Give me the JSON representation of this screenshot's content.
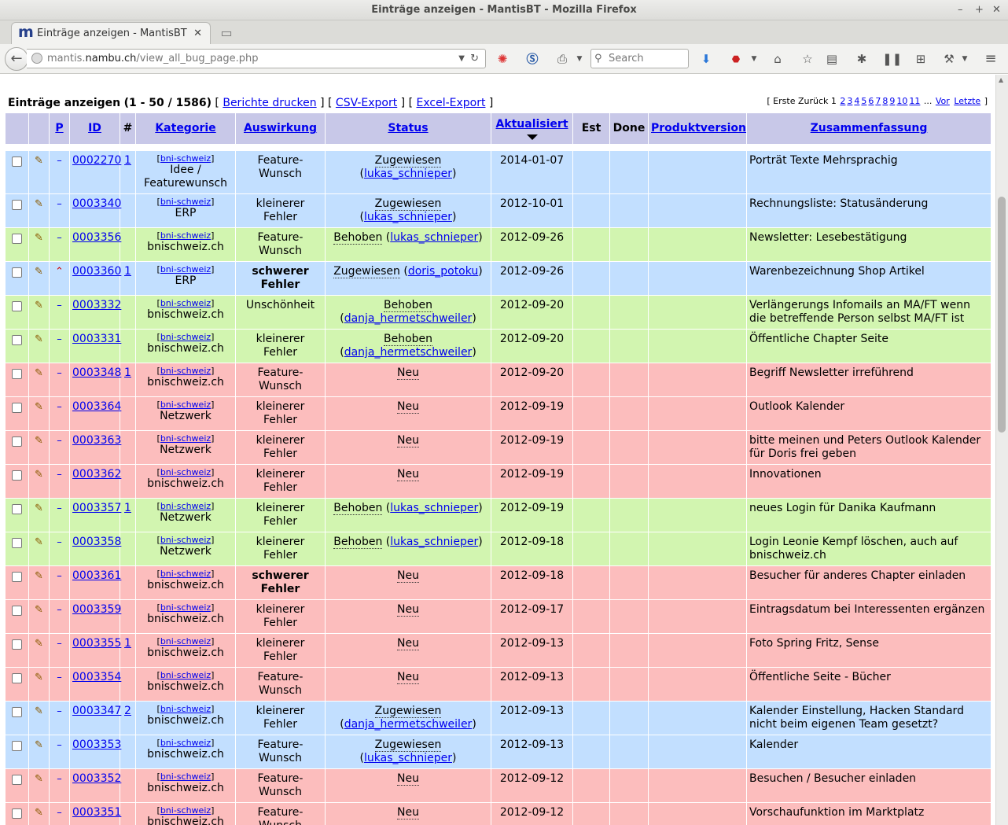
{
  "window": {
    "title": "Einträge anzeigen - MantisBT - Mozilla Firefox"
  },
  "tab": {
    "title": "Einträge anzeigen - MantisBT",
    "favicon_letter": "m"
  },
  "url": {
    "scheme_host_prefix": "mantis.",
    "host": "nambu.ch",
    "path": "/view_all_bug_page.php"
  },
  "search": {
    "placeholder": "Search"
  },
  "header": {
    "title": "Einträge anzeigen",
    "range": "(1 - 50 / 1586)",
    "links": [
      "Berichte drucken",
      "CSV-Export",
      "Excel-Export"
    ],
    "pagination": {
      "first": "Erste",
      "back": "Zurück",
      "current": "1",
      "pages": [
        "2",
        "3",
        "4",
        "5",
        "6",
        "7",
        "8",
        "9",
        "10",
        "11"
      ],
      "ellipsis": "...",
      "next": "Vor",
      "last": "Letzte"
    }
  },
  "columns": [
    "P",
    "ID",
    "#",
    "Kategorie",
    "Auswirkung",
    "Status",
    "Aktualisiert",
    "Est",
    "Done",
    "Produktversion",
    "Zusammenfassung"
  ],
  "rows": [
    {
      "status_class": "assigned",
      "prio": "normal",
      "id": "0002270",
      "notes": "1",
      "project": "bni-schweiz",
      "category": "Idee / Featurewunsch",
      "severity": "Feature-Wunsch",
      "bold_sev": false,
      "status": "Zugewiesen",
      "handler": "lukas_schnieper",
      "split": true,
      "updated": "2014-01-07",
      "summary": "Porträt Texte Mehrsprachig"
    },
    {
      "status_class": "assigned",
      "prio": "normal",
      "id": "0003340",
      "notes": "",
      "project": "bni-schweiz",
      "category": "ERP",
      "severity": "kleinerer Fehler",
      "bold_sev": false,
      "status": "Zugewiesen",
      "handler": "lukas_schnieper",
      "split": true,
      "updated": "2012-10-01",
      "summary": "Rechnungsliste: Statusänderung"
    },
    {
      "status_class": "resolved",
      "prio": "normal",
      "id": "0003356",
      "notes": "",
      "project": "bni-schweiz",
      "category": "bnischweiz.ch",
      "severity": "Feature-Wunsch",
      "bold_sev": false,
      "status": "Behoben",
      "handler": "lukas_schnieper",
      "split": false,
      "updated": "2012-09-26",
      "summary": "Newsletter: Lesebestätigung"
    },
    {
      "status_class": "assigned",
      "prio": "high",
      "id": "0003360",
      "notes": "1",
      "project": "bni-schweiz",
      "category": "ERP",
      "severity": "schwerer Fehler",
      "bold_sev": true,
      "status": "Zugewiesen",
      "handler": "doris_potoku",
      "split": false,
      "updated": "2012-09-26",
      "summary": "Warenbezeichnung Shop Artikel"
    },
    {
      "status_class": "resolved",
      "prio": "normal",
      "id": "0003332",
      "notes": "",
      "project": "bni-schweiz",
      "category": "bnischweiz.ch",
      "severity": "Unschönheit",
      "bold_sev": false,
      "status": "Behoben",
      "handler": "danja_hermetschweiler",
      "split": true,
      "updated": "2012-09-20",
      "summary": "Verlängerungs Infomails an MA/FT wenn die betreffende Person selbst MA/FT ist"
    },
    {
      "status_class": "resolved",
      "prio": "normal",
      "id": "0003331",
      "notes": "",
      "project": "bni-schweiz",
      "category": "bnischweiz.ch",
      "severity": "kleinerer Fehler",
      "bold_sev": false,
      "status": "Behoben",
      "handler": "danja_hermetschweiler",
      "split": true,
      "updated": "2012-09-20",
      "summary": "Öffentliche Chapter Seite"
    },
    {
      "status_class": "neu",
      "prio": "normal",
      "id": "0003348",
      "notes": "1",
      "project": "bni-schweiz",
      "category": "bnischweiz.ch",
      "severity": "Feature-Wunsch",
      "bold_sev": false,
      "status": "Neu",
      "handler": "",
      "split": false,
      "updated": "2012-09-20",
      "summary": "Begriff Newsletter irreführend"
    },
    {
      "status_class": "neu",
      "prio": "normal",
      "id": "0003364",
      "notes": "",
      "project": "bni-schweiz",
      "category": "Netzwerk",
      "severity": "kleinerer Fehler",
      "bold_sev": false,
      "status": "Neu",
      "handler": "",
      "split": false,
      "updated": "2012-09-19",
      "summary": "Outlook Kalender"
    },
    {
      "status_class": "neu",
      "prio": "normal",
      "id": "0003363",
      "notes": "",
      "project": "bni-schweiz",
      "category": "Netzwerk",
      "severity": "kleinerer Fehler",
      "bold_sev": false,
      "status": "Neu",
      "handler": "",
      "split": false,
      "updated": "2012-09-19",
      "summary": "bitte meinen und Peters Outlook Kalender für Doris frei geben"
    },
    {
      "status_class": "neu",
      "prio": "normal",
      "id": "0003362",
      "notes": "",
      "project": "bni-schweiz",
      "category": "bnischweiz.ch",
      "severity": "kleinerer Fehler",
      "bold_sev": false,
      "status": "Neu",
      "handler": "",
      "split": false,
      "updated": "2012-09-19",
      "summary": "Innovationen"
    },
    {
      "status_class": "resolved",
      "prio": "normal",
      "id": "0003357",
      "notes": "1",
      "project": "bni-schweiz",
      "category": "Netzwerk",
      "severity": "kleinerer Fehler",
      "bold_sev": false,
      "status": "Behoben",
      "handler": "lukas_schnieper",
      "split": false,
      "updated": "2012-09-19",
      "summary": "neues Login für Danika Kaufmann"
    },
    {
      "status_class": "resolved",
      "prio": "normal",
      "id": "0003358",
      "notes": "",
      "project": "bni-schweiz",
      "category": "Netzwerk",
      "severity": "kleinerer Fehler",
      "bold_sev": false,
      "status": "Behoben",
      "handler": "lukas_schnieper",
      "split": false,
      "updated": "2012-09-18",
      "summary": "Login Leonie Kempf löschen, auch auf bnischweiz.ch"
    },
    {
      "status_class": "neu",
      "prio": "normal",
      "id": "0003361",
      "notes": "",
      "project": "bni-schweiz",
      "category": "bnischweiz.ch",
      "severity": "schwerer Fehler",
      "bold_sev": true,
      "status": "Neu",
      "handler": "",
      "split": false,
      "updated": "2012-09-18",
      "summary": "Besucher für anderes Chapter einladen"
    },
    {
      "status_class": "neu",
      "prio": "normal",
      "id": "0003359",
      "notes": "",
      "project": "bni-schweiz",
      "category": "bnischweiz.ch",
      "severity": "kleinerer Fehler",
      "bold_sev": false,
      "status": "Neu",
      "handler": "",
      "split": false,
      "updated": "2012-09-17",
      "summary": "Eintragsdatum bei Interessenten ergänzen"
    },
    {
      "status_class": "neu",
      "prio": "normal",
      "id": "0003355",
      "notes": "1",
      "project": "bni-schweiz",
      "category": "bnischweiz.ch",
      "severity": "kleinerer Fehler",
      "bold_sev": false,
      "status": "Neu",
      "handler": "",
      "split": false,
      "updated": "2012-09-13",
      "summary": "Foto Spring Fritz, Sense"
    },
    {
      "status_class": "neu",
      "prio": "normal",
      "id": "0003354",
      "notes": "",
      "project": "bni-schweiz",
      "category": "bnischweiz.ch",
      "severity": "Feature-Wunsch",
      "bold_sev": false,
      "status": "Neu",
      "handler": "",
      "split": false,
      "updated": "2012-09-13",
      "summary": "Öffentliche Seite - Bücher"
    },
    {
      "status_class": "assigned",
      "prio": "normal",
      "id": "0003347",
      "notes": "2",
      "project": "bni-schweiz",
      "category": "bnischweiz.ch",
      "severity": "kleinerer Fehler",
      "bold_sev": false,
      "status": "Zugewiesen",
      "handler": "danja_hermetschweiler",
      "split": true,
      "updated": "2012-09-13",
      "summary": "Kalender Einstellung, Hacken Standard nicht beim eigenen Team gesetzt?"
    },
    {
      "status_class": "assigned",
      "prio": "normal",
      "id": "0003353",
      "notes": "",
      "project": "bni-schweiz",
      "category": "bnischweiz.ch",
      "severity": "Feature-Wunsch",
      "bold_sev": false,
      "status": "Zugewiesen",
      "handler": "lukas_schnieper",
      "split": true,
      "updated": "2012-09-13",
      "summary": "Kalender"
    },
    {
      "status_class": "neu",
      "prio": "normal",
      "id": "0003352",
      "notes": "",
      "project": "bni-schweiz",
      "category": "bnischweiz.ch",
      "severity": "Feature-Wunsch",
      "bold_sev": false,
      "status": "Neu",
      "handler": "",
      "split": false,
      "updated": "2012-09-12",
      "summary": "Besuchen / Besucher einladen"
    },
    {
      "status_class": "neu",
      "prio": "normal",
      "id": "0003351",
      "notes": "",
      "project": "bni-schweiz",
      "category": "bnischweiz.ch",
      "severity": "Feature-Wunsch",
      "bold_sev": false,
      "status": "Neu",
      "handler": "",
      "split": false,
      "updated": "2012-09-12",
      "summary": "Vorschaufunktion im Marktplatz"
    }
  ]
}
